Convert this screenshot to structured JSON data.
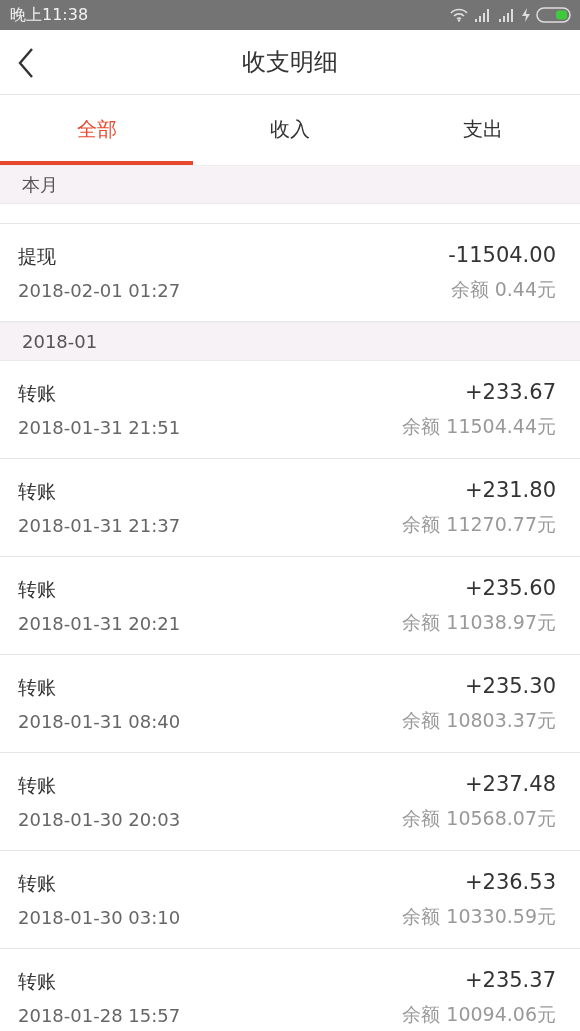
{
  "status_bar": {
    "time": "晚上11:38"
  },
  "header": {
    "title": "收支明细"
  },
  "tabs": [
    {
      "label": "全部",
      "selected": true
    },
    {
      "label": "收入",
      "selected": false
    },
    {
      "label": "支出",
      "selected": false
    }
  ],
  "sections": [
    {
      "title": "本月",
      "cut_row": true,
      "rows": [
        {
          "type": "提现",
          "time": "2018-02-01 01:27",
          "amount": "-11504.00",
          "balance": "余额 0.44元"
        }
      ]
    },
    {
      "title": "2018-01",
      "rows": [
        {
          "type": "转账",
          "time": "2018-01-31 21:51",
          "amount": "+233.67",
          "balance": "余额 11504.44元"
        },
        {
          "type": "转账",
          "time": "2018-01-31 21:37",
          "amount": "+231.80",
          "balance": "余额 11270.77元"
        },
        {
          "type": "转账",
          "time": "2018-01-31 20:21",
          "amount": "+235.60",
          "balance": "余额 11038.97元"
        },
        {
          "type": "转账",
          "time": "2018-01-31 08:40",
          "amount": "+235.30",
          "balance": "余额 10803.37元"
        },
        {
          "type": "转账",
          "time": "2018-01-30 20:03",
          "amount": "+237.48",
          "balance": "余额 10568.07元"
        },
        {
          "type": "转账",
          "time": "2018-01-30 03:10",
          "amount": "+236.53",
          "balance": "余额 10330.59元"
        },
        {
          "type": "转账",
          "time": "2018-01-28 15:57",
          "amount": "+235.37",
          "balance": "余额 10094.06元"
        }
      ]
    }
  ]
}
